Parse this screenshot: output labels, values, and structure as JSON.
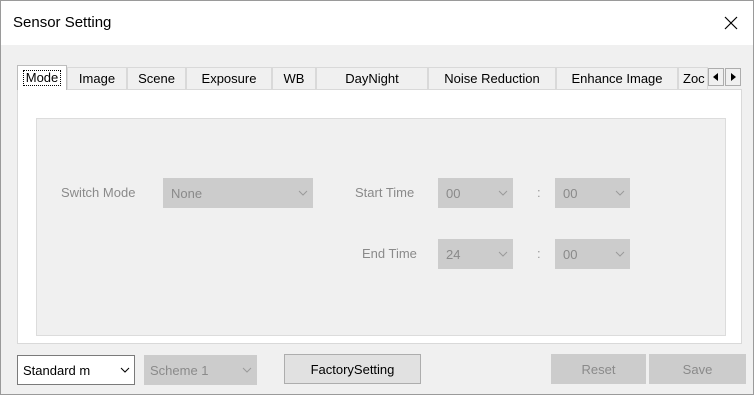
{
  "window": {
    "title": "Sensor Setting",
    "close_glyph": "✕"
  },
  "tabs": [
    {
      "label": "Mode",
      "active": true
    },
    {
      "label": "Image"
    },
    {
      "label": "Scene"
    },
    {
      "label": "Exposure"
    },
    {
      "label": "WB"
    },
    {
      "label": "DayNight"
    },
    {
      "label": "Noise Reduction"
    },
    {
      "label": "Enhance Image"
    },
    {
      "label": "Zoc"
    }
  ],
  "tab_scroll": {
    "left_icon": "triangle-left-icon",
    "right_icon": "triangle-right-icon"
  },
  "mode_panel": {
    "switch_mode_label": "Switch Mode",
    "switch_mode_value": "None",
    "start_time_label": "Start Time",
    "start_hour": "00",
    "start_minute": "00",
    "end_time_label": "End Time",
    "end_hour": "24",
    "end_minute": "00",
    "separator": ":"
  },
  "bottom": {
    "standard_mode_value": "Standard m",
    "scheme_value": "Scheme 1",
    "factory_setting_label": "FactorySetting",
    "reset_label": "Reset",
    "save_label": "Save"
  },
  "colors": {
    "disabled_text": "#8a8a8a",
    "disabled_fill": "#cccccc",
    "dialog_bg": "#f0f0f0"
  }
}
